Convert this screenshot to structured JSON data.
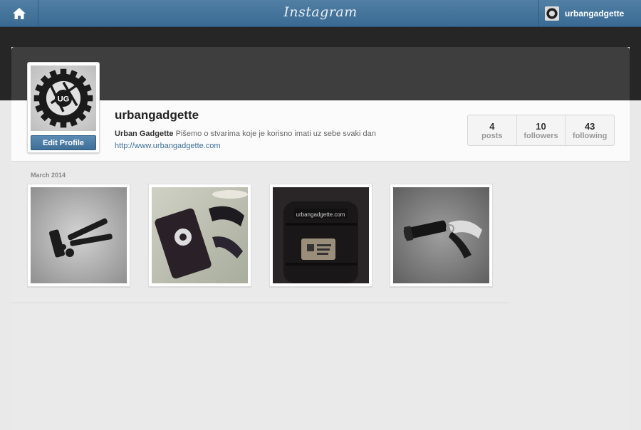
{
  "topbar": {
    "brand": "Instagram",
    "home_icon": "home-icon",
    "username": "urbangadgette"
  },
  "profile": {
    "username": "urbangadgette",
    "edit_label": "Edit Profile",
    "full_name": "Urban Gadgette",
    "bio": "Pišemo o stvarima koje je korisno imati uz sebe svaki dan",
    "website": "http://www.urbangadgette.com",
    "avatar_text": "UG"
  },
  "stats": [
    {
      "num": "4",
      "label": "posts"
    },
    {
      "num": "10",
      "label": "followers"
    },
    {
      "num": "43",
      "label": "following"
    }
  ],
  "feed": {
    "month": "March 2014",
    "photos": [
      {
        "name": "multitool-photo"
      },
      {
        "name": "phone-photo"
      },
      {
        "name": "backpack-photo",
        "patch_text": "urbangadgette.com"
      },
      {
        "name": "flashlight-knife-photo"
      }
    ]
  },
  "colors": {
    "topbar": "#3f6f97",
    "link": "#3f729b"
  }
}
